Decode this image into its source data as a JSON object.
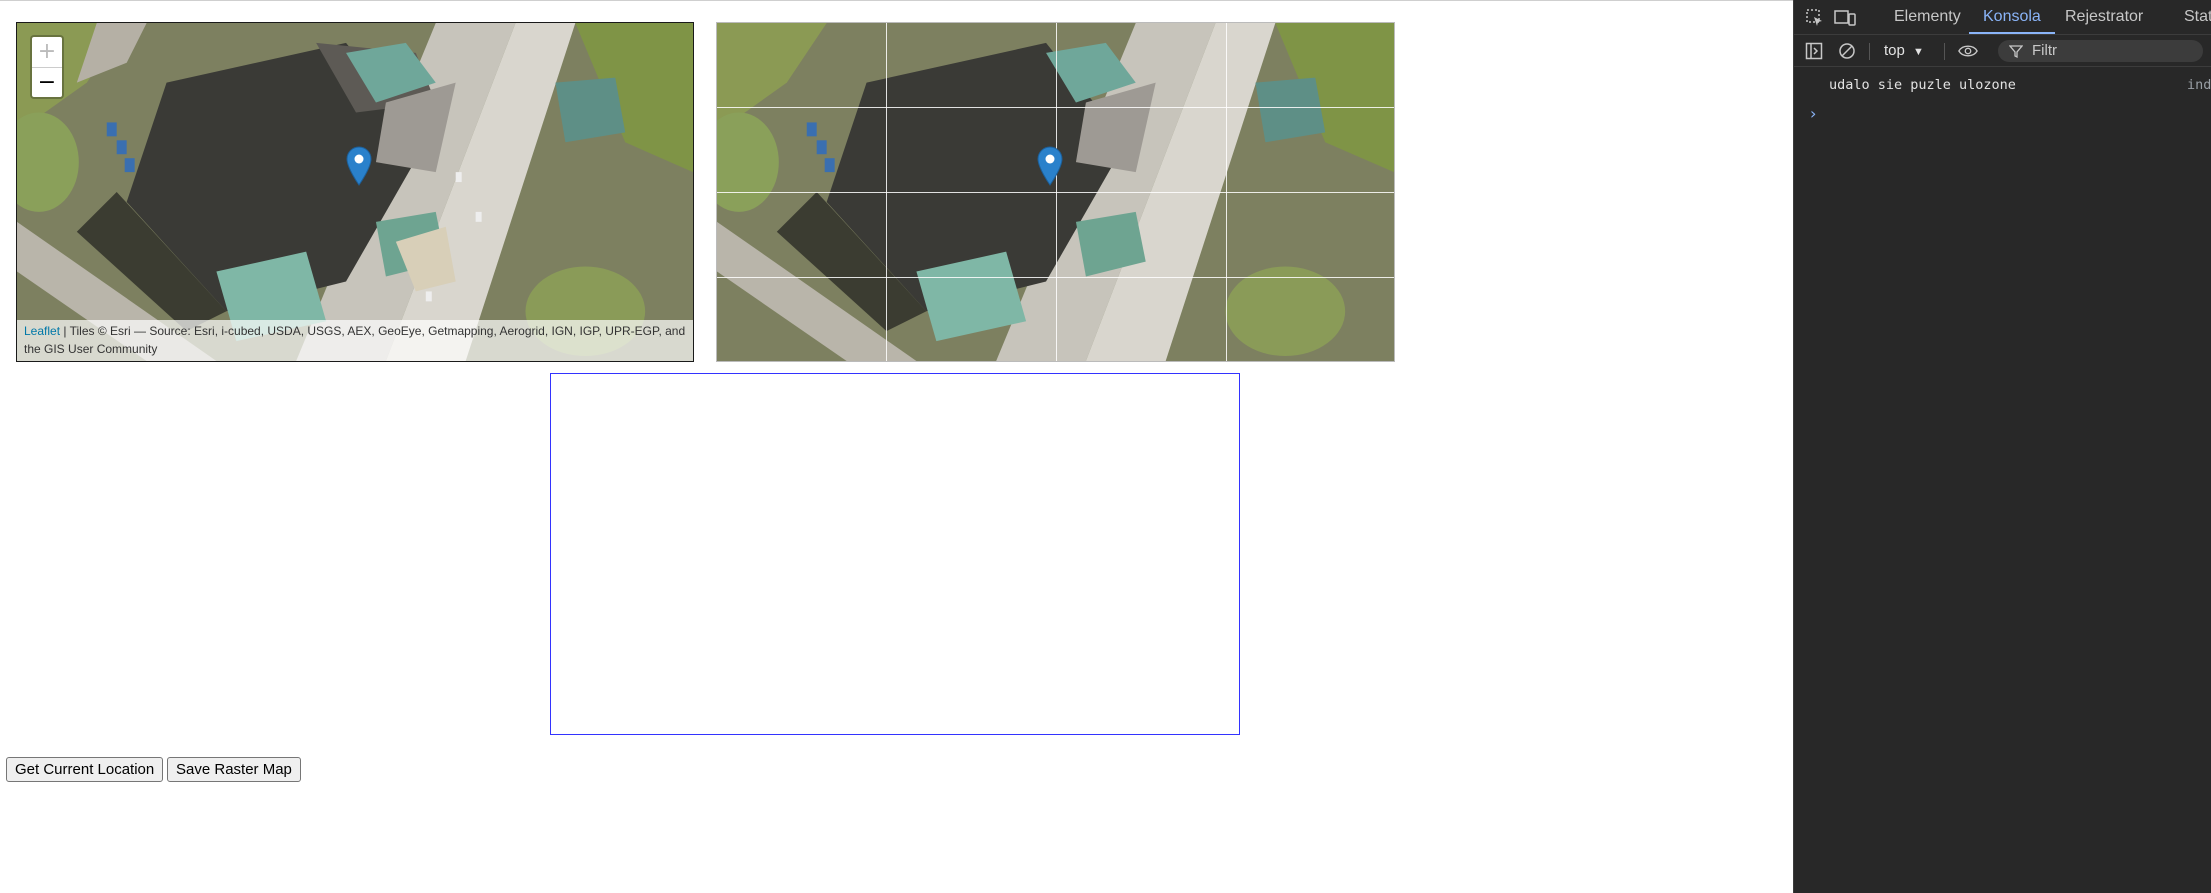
{
  "map_left": {
    "zoom_in_label": "+",
    "zoom_out_label": "−",
    "attribution_link": "Leaflet",
    "attribution_text": " | Tiles © Esri — Source: Esri, i-cubed, USDA, USGS, AEX, GeoEye, Getmapping, Aerogrid, IGN, IGP, UPR-EGP, and the GIS User Community"
  },
  "map_right": {
    "grid": {
      "columns": 4,
      "rows": 4
    }
  },
  "buttons": {
    "get_location": "Get Current Location",
    "save_raster": "Save Raster Map"
  },
  "devtools": {
    "tabs": [
      "Elementy",
      "Konsola",
      "Rejestrator",
      "Staty"
    ],
    "active_tab": "Konsola",
    "context": "top",
    "filter_placeholder": "Filtr",
    "console_message": "udalo sie puzle ulozone",
    "console_source": "ind",
    "accent_color": "#8ab4f8"
  },
  "colors": {
    "marker": "#2a81cb",
    "drop_border": "#3333ff"
  }
}
